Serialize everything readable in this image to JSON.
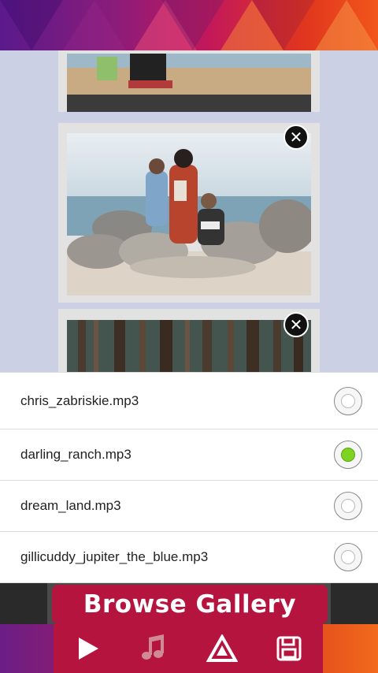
{
  "photos": [
    {
      "icon": "photo-beach-partial"
    },
    {
      "icon": "photo-family-rocks",
      "remove_icon": "close-icon",
      "remove_glyph": "✕"
    },
    {
      "icon": "photo-forest-trees",
      "remove_icon": "close-icon",
      "remove_glyph": "✕"
    }
  ],
  "music": {
    "tracks": [
      {
        "name": "chris_zabriskie.mp3",
        "selected": false
      },
      {
        "name": "darling_ranch.mp3",
        "selected": true
      },
      {
        "name": "dream_land.mp3",
        "selected": false
      },
      {
        "name": "gillicuddy_jupiter_the_blue.mp3",
        "selected": false
      }
    ],
    "selected_color": "#7ed321"
  },
  "browse_button": {
    "label": "Browse Gallery"
  },
  "nav": {
    "items": [
      {
        "icon": "play-icon"
      },
      {
        "icon": "music-note-icon"
      },
      {
        "icon": "theme-triangle-icon"
      },
      {
        "icon": "save-icon"
      }
    ]
  },
  "colors": {
    "accent": "#b5143f",
    "background": "#ccd0e4"
  }
}
